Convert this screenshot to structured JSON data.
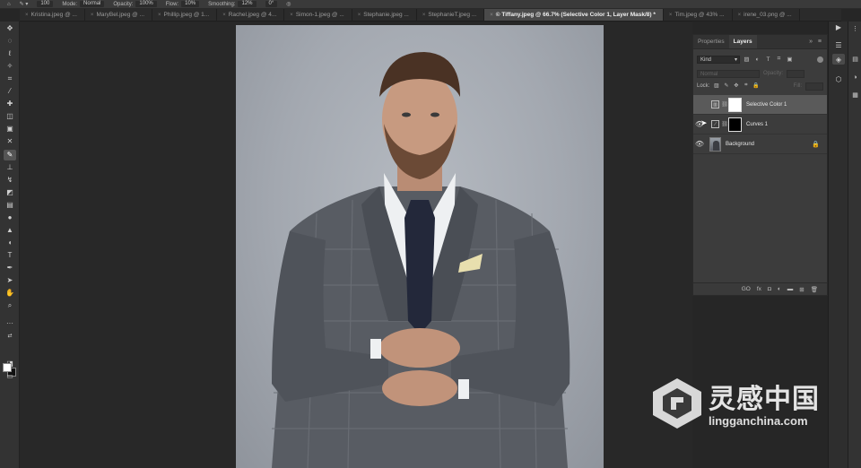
{
  "options_bar": {
    "size": "100",
    "mode_label": "Mode:",
    "mode_value": "Normal",
    "opacity_label": "Opacity:",
    "opacity_value": "100%",
    "flow_label": "Flow:",
    "flow_value": "10%",
    "smoothing_label": "Smoothing:",
    "smoothing_value": "12%",
    "angle_value": "0°"
  },
  "tabs": [
    {
      "label": "Kristina.jpeg @ ..."
    },
    {
      "label": "MaryBel.jpeg @ ..."
    },
    {
      "label": "Phillip.jpeg @ 1..."
    },
    {
      "label": "Rachel.jpeg @ 4..."
    },
    {
      "label": "Simon-1.jpeg @ ..."
    },
    {
      "label": "Stephanie.jpeg ..."
    },
    {
      "label": "StephanieT.jpeg ..."
    },
    {
      "label": "© Tiffany.jpeg @ 66.7% (Selective Color 1, Layer Mask/8) *",
      "active": true
    },
    {
      "label": "Tim.jpeg @ 43% ..."
    },
    {
      "label": "irene_03.png @ ..."
    }
  ],
  "panel": {
    "tab_properties": "Properties",
    "tab_layers": "Layers",
    "controls": "»  ≡",
    "kind_label": "Kind",
    "blend_mode": "Normal",
    "opacity_label": "Opacity:",
    "lock_label": "Lock:",
    "fill_label": "Fill:",
    "layers": [
      {
        "name": "Selective Color 1",
        "selected": true,
        "visible": false
      },
      {
        "name": "Curves 1",
        "selected": false,
        "visible": true
      },
      {
        "name": "Background",
        "selected": false,
        "visible": true,
        "locked": true
      }
    ],
    "bottom_icons": [
      "GO",
      "fx",
      "◘",
      "◐",
      "▬",
      "⊞",
      "🗑"
    ]
  },
  "watermark": {
    "chinese": "灵感中国",
    "url": "lingganchina.com"
  }
}
